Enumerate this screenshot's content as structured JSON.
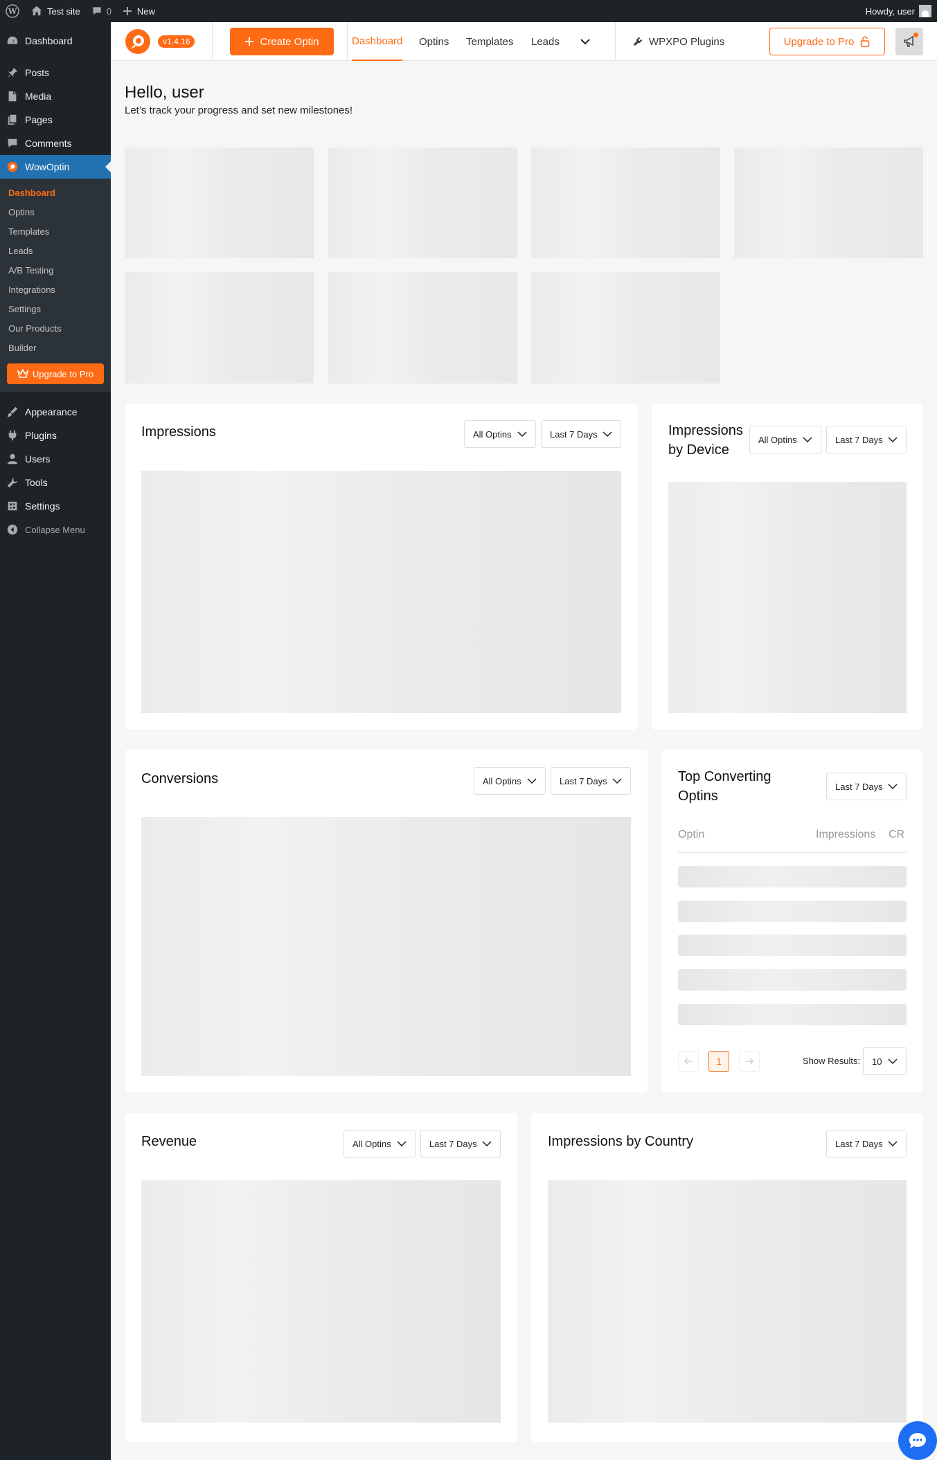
{
  "admin_bar": {
    "site_name": "Test site",
    "comments_count": "0",
    "new_label": "New",
    "howdy": "Howdy, user"
  },
  "sidebar": {
    "items_top": [
      {
        "label": "Dashboard",
        "icon": "dashboard-icon"
      },
      {
        "label": "Posts",
        "icon": "pin-icon"
      },
      {
        "label": "Media",
        "icon": "media-icon"
      },
      {
        "label": "Pages",
        "icon": "pages-icon"
      },
      {
        "label": "Comments",
        "icon": "comment-icon"
      },
      {
        "label": "WowOptin",
        "icon": "wowoptin-icon"
      }
    ],
    "submenu": [
      "Dashboard",
      "Optins",
      "Templates",
      "Leads",
      "A/B Testing",
      "Integrations",
      "Settings",
      "Our Products",
      "Builder"
    ],
    "upgrade_label": "Upgrade to Pro",
    "items_bottom": [
      {
        "label": "Appearance",
        "icon": "brush-icon"
      },
      {
        "label": "Plugins",
        "icon": "plugin-icon"
      },
      {
        "label": "Users",
        "icon": "user-icon"
      },
      {
        "label": "Tools",
        "icon": "wrench-icon"
      },
      {
        "label": "Settings",
        "icon": "settings-icon"
      }
    ],
    "collapse_label": "Collapse Menu"
  },
  "header": {
    "version": "v1.4.16",
    "create_label": "Create Optin",
    "tabs": [
      "Dashboard",
      "Optins",
      "Templates",
      "Leads"
    ],
    "active_tab": "Dashboard",
    "wpxpo_label": "WPXPO Plugins",
    "upgrade_label": "Upgrade to Pro",
    "accent": "#ff6a14"
  },
  "greeting": {
    "title": "Hello, user",
    "subtitle": "Let’s track your progress and set new milestones!"
  },
  "filters": {
    "all_optins": "All Optins",
    "last_7_days": "Last 7 Days"
  },
  "cards": {
    "impressions": "Impressions",
    "impressions_by_device_line1": "Impressions",
    "impressions_by_device_line2": "by Device",
    "conversions": "Conversions",
    "top_converting_line1": "Top Converting",
    "top_converting_line2": "Optins",
    "revenue": "Revenue",
    "impressions_by_country": "Impressions by Country"
  },
  "top_table": {
    "columns": [
      "Optin",
      "Impressions",
      "CR"
    ],
    "page": "1",
    "show_results_label": "Show Results:",
    "show_results_value": "10"
  }
}
